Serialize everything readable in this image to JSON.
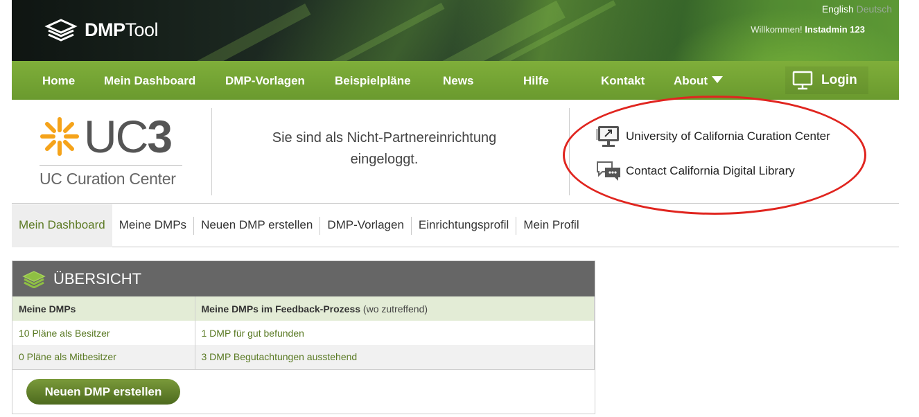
{
  "header": {
    "brand_bold": "DMP",
    "brand_light": "Tool",
    "lang_active": "English",
    "lang_other": "Deutsch",
    "welcome_prefix": "Willkommen!",
    "welcome_user": "Instadmin 123"
  },
  "nav": {
    "items": [
      "Home",
      "Mein Dashboard",
      "DMP-Vorlagen",
      "Beispielpläne",
      "News",
      "Hilfe",
      "Kontakt",
      "About"
    ],
    "login": "Login"
  },
  "org": {
    "logo_word_light": "UC",
    "logo_word_bold": "3",
    "logo_sub": "UC Curation Center",
    "partner_line1": "Sie sind als Nicht-Partnereinrichtung",
    "partner_line2": "eingeloggt.",
    "links": [
      "University of California Curation Center",
      "Contact California Digital Library"
    ],
    "highlight_color": "#e0251f"
  },
  "subnav": {
    "items": [
      "Mein Dashboard",
      "Meine DMPs",
      "Neuen DMP erstellen",
      "DMP-Vorlagen",
      "Einrichtungsprofil",
      "Mein Profil"
    ],
    "active": "Mein Dashboard"
  },
  "overview": {
    "title": "ÜBERSICHT",
    "col1_header": "Meine DMPs",
    "col2_header": "Meine DMPs im Feedback-Prozess",
    "col2_note": "(wo zutreffend)",
    "rows": [
      [
        "10 Pläne als Besitzer",
        "1 DMP für gut befunden"
      ],
      [
        "0 Pläne als Mitbesitzer",
        "3 DMP Begutachtungen ausstehend"
      ]
    ],
    "button": "Neuen DMP erstellen"
  },
  "colors": {
    "nav_green": "#7fae3a",
    "link_green": "#5a7a24",
    "panel_header": "#666666",
    "accent_orange": "#f5a31a"
  }
}
